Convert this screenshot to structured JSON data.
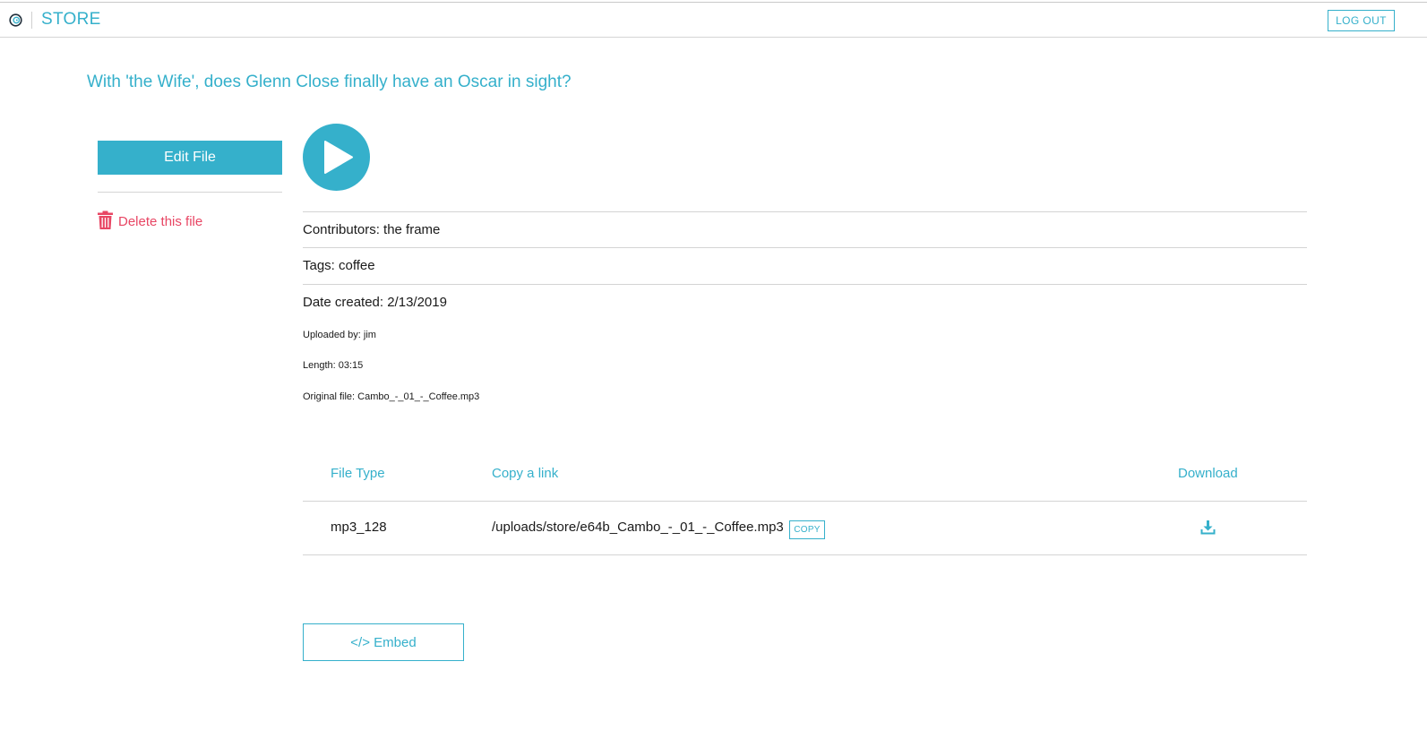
{
  "header": {
    "brand": "STORE",
    "logout_label": "LOG OUT"
  },
  "page": {
    "title": "With 'the Wife', does Glenn Close finally have an Oscar in sight?"
  },
  "sidebar": {
    "edit_label": "Edit File",
    "delete_label": "Delete this file"
  },
  "meta": {
    "contributors": "Contributors: the frame",
    "tags": "Tags: coffee",
    "date_created": "Date created: 2/13/2019",
    "uploaded_by": "Uploaded by: jim",
    "length": "Length: 03:15",
    "original_file": "Original file: Cambo_-_01_-_Coffee.mp3"
  },
  "files_table": {
    "headers": [
      "File Type",
      "Copy a link",
      "Download"
    ],
    "rows": [
      {
        "file_type": "mp3_128",
        "link": "/uploads/store/e64b_Cambo_-_01_-_Coffee.mp3",
        "copy_label": "COPY"
      }
    ]
  },
  "embed_label": "</> Embed",
  "colors": {
    "accent": "#35b0cb",
    "danger": "#e84664",
    "divider": "#d4d4d4"
  },
  "icons": {
    "logo": "spiral-logo-icon",
    "play": "play-icon",
    "delete": "trash-icon",
    "download": "download-icon"
  }
}
